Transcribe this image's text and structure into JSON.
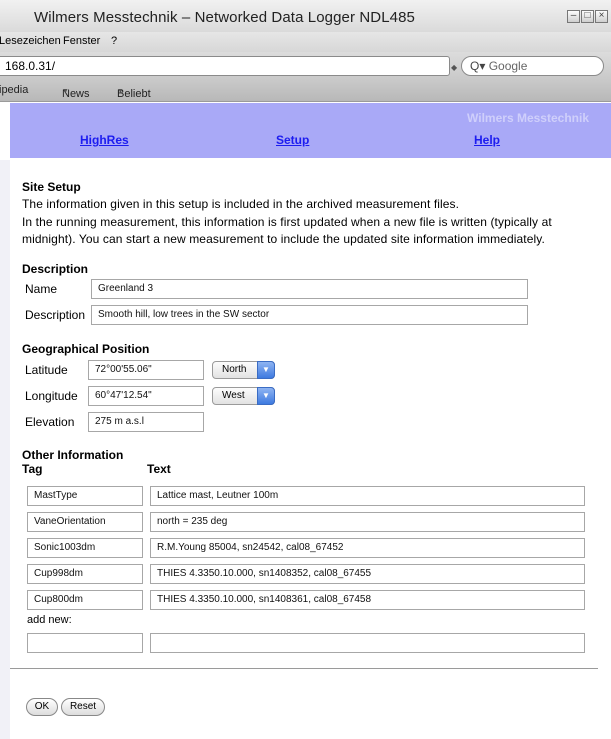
{
  "window": {
    "title": "Wilmers Messtechnik – Networked Data Logger NDL485",
    "controls": [
      "minimize-icon",
      "maximize-icon",
      "close-icon"
    ]
  },
  "menubar": {
    "items": [
      "Lesezeichen",
      "Fenster",
      "?"
    ]
  },
  "addressbar": {
    "url": "168.0.31/",
    "search_placeholder": "Google"
  },
  "bookmarks": {
    "items": [
      "ipedia",
      "News",
      "Beliebt"
    ]
  },
  "header": {
    "brand": "Wilmers Messtechnik",
    "nav": [
      "HighRes",
      "Setup",
      "Help"
    ]
  },
  "site_setup": {
    "heading": "Site Setup",
    "info1": "The information given in this setup is included in the archived measurement files.",
    "info2": "In the running measurement, this information is first updated when a new file is written (typically at",
    "info3": "midnight). You can start a new measurement to include the updated site information immediately."
  },
  "description": {
    "heading": "Description",
    "name_label": "Name",
    "name_value": "Greenland 3",
    "desc_label": "Description",
    "desc_value": "Smooth hill, low trees in the SW sector"
  },
  "geo": {
    "heading": "Geographical Position",
    "lat_label": "Latitude",
    "lat_value": "72°00'55.06\"",
    "lat_dir": "North",
    "lon_label": "Longitude",
    "lon_value": "60°47'12.54\"",
    "lon_dir": "West",
    "elev_label": "Elevation",
    "elev_value": "275 m a.s.l"
  },
  "other": {
    "heading": "Other Information",
    "col_tag": "Tag",
    "col_text": "Text",
    "rows": [
      {
        "tag": "MastType",
        "text": "Lattice  mast, Leutner  100m"
      },
      {
        "tag": "VaneOrientation",
        "text": "north = 235 deg"
      },
      {
        "tag": "Sonic1003dm",
        "text": "R.M.Young 85004, sn24542, cal08_67452"
      },
      {
        "tag": "Cup998dm",
        "text": "THIES 4.3350.10.000, sn1408352, cal08_67455"
      },
      {
        "tag": "Cup800dm",
        "text": "THIES 4.3350.10.000, sn1408361, cal08_67458"
      }
    ],
    "add_new_label": "add new:",
    "new_tag": "",
    "new_text": ""
  },
  "buttons": {
    "ok": "OK",
    "reset": "Reset"
  }
}
